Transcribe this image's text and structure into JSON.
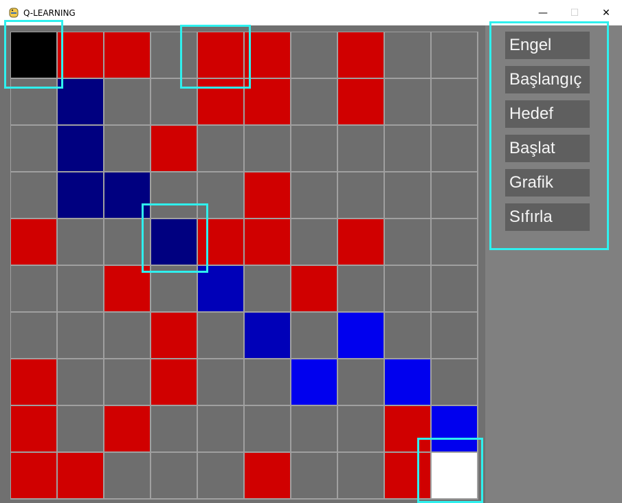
{
  "window": {
    "title": "Q-LEARNING",
    "minimize_glyph": "—",
    "maximize_glyph": "☐",
    "close_glyph": "✕",
    "icon": "python-icon"
  },
  "colors": {
    "empty": "#6e6e6e",
    "obstacle": "#d00000",
    "start": "#000000",
    "goal": "#ffffff",
    "path_dark": "#000080",
    "path_mid": "#0000b8",
    "path_bright": "#0000ee",
    "highlight": "#2ff0ee"
  },
  "grid": {
    "rows": 10,
    "cols": 10,
    "cells": [
      [
        "start",
        "obstacle",
        "obstacle",
        "empty",
        "obstacle",
        "obstacle",
        "empty",
        "obstacle",
        "empty",
        "empty"
      ],
      [
        "empty",
        "path_dark",
        "empty",
        "empty",
        "obstacle",
        "obstacle",
        "empty",
        "obstacle",
        "empty",
        "empty"
      ],
      [
        "empty",
        "path_dark",
        "empty",
        "obstacle",
        "empty",
        "empty",
        "empty",
        "empty",
        "empty",
        "empty"
      ],
      [
        "empty",
        "path_dark",
        "path_dark",
        "empty",
        "empty",
        "obstacle",
        "empty",
        "empty",
        "empty",
        "empty"
      ],
      [
        "obstacle",
        "empty",
        "empty",
        "path_dark",
        "obstacle",
        "obstacle",
        "empty",
        "obstacle",
        "empty",
        "empty"
      ],
      [
        "empty",
        "empty",
        "obstacle",
        "empty",
        "path_mid",
        "empty",
        "obstacle",
        "empty",
        "empty",
        "empty"
      ],
      [
        "empty",
        "empty",
        "empty",
        "obstacle",
        "empty",
        "path_mid",
        "empty",
        "path_bright",
        "empty",
        "empty"
      ],
      [
        "obstacle",
        "empty",
        "empty",
        "obstacle",
        "empty",
        "empty",
        "path_bright",
        "empty",
        "path_bright",
        "empty"
      ],
      [
        "obstacle",
        "empty",
        "obstacle",
        "empty",
        "empty",
        "empty",
        "empty",
        "empty",
        "obstacle",
        "path_bright"
      ],
      [
        "obstacle",
        "obstacle",
        "empty",
        "empty",
        "empty",
        "obstacle",
        "empty",
        "empty",
        "obstacle",
        "goal"
      ]
    ]
  },
  "menu": {
    "items": [
      {
        "label": "Engel"
      },
      {
        "label": "Başlangıç"
      },
      {
        "label": "Hedef"
      },
      {
        "label": "Başlat"
      },
      {
        "label": "Grafik"
      },
      {
        "label": "Sıfırla"
      }
    ]
  }
}
